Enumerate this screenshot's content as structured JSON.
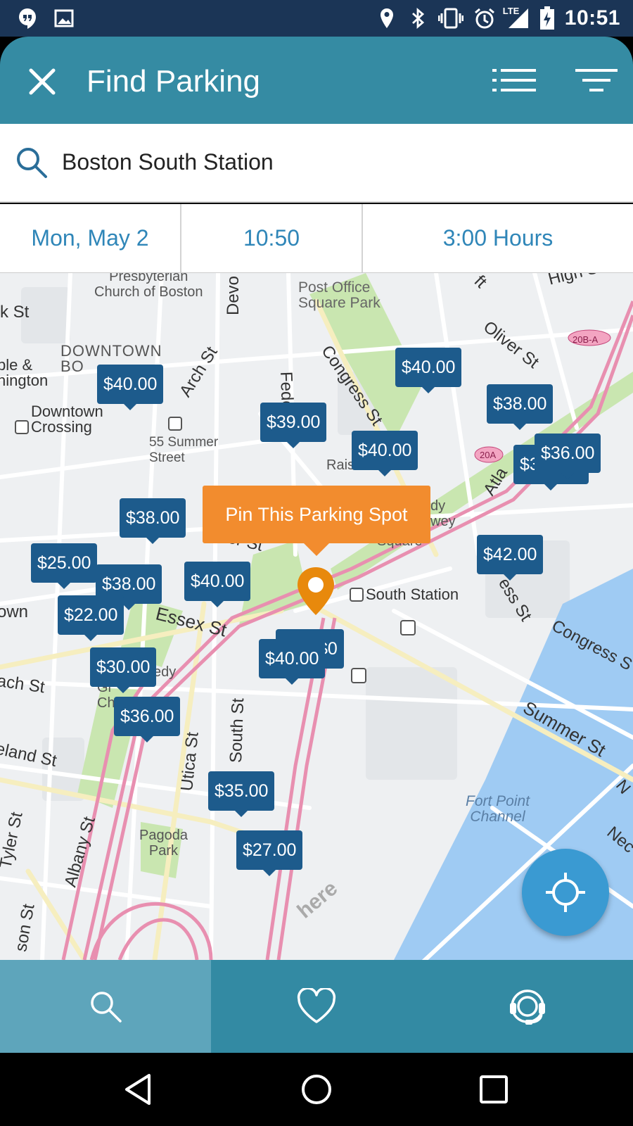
{
  "status_bar": {
    "time": "10:51",
    "network_label": "LTE",
    "icons": [
      "hangouts-icon",
      "image-icon",
      "location-icon",
      "bluetooth-icon",
      "vibrate-icon",
      "alarm-icon",
      "signal-icon",
      "battery-charging-icon"
    ]
  },
  "app_bar": {
    "title": "Find Parking",
    "close_icon": "close-icon",
    "list_icon": "list-view-icon",
    "filter_icon": "filter-icon"
  },
  "search": {
    "value": "Boston South Station",
    "icon": "search-icon"
  },
  "booking": {
    "date": "Mon, May 2",
    "time": "10:50",
    "duration": "3:00 Hours"
  },
  "map": {
    "place_labels": {
      "presbyterian": "Presbyterian\nChurch of Boston",
      "post_office": "Post Office\nSquare Park",
      "downtown": "DOWNTOWN\nBO",
      "temple": "ple &\nhington",
      "downtown_crossing": "Downtown\nCrossing",
      "summer_street": "55 Summer\nStreet",
      "south_station": "South Station",
      "fort_point": "Fort Point\nChannel",
      "pagoda": "Pagoda\nPark",
      "square": "Square",
      "greenway": "dy\nwey",
      "rais": "Rais",
      "gr": "Gr\nCh",
      "edy": "edy",
      "here_watermark": "here",
      "route_20a": "20A",
      "route_20ba": "20B-A"
    },
    "streets": {
      "high_st": "High St",
      "oliver_st": "Oliver St",
      "congress_st": "Congress St",
      "congress_s2": "Congress S",
      "federal": "Federa",
      "arch_st": "Arch St",
      "devo": "Devo",
      "k_st": "k St",
      "essex_st": "Essex St",
      "summer_st": "Summer St",
      "atla": "Atla",
      "ess_st": "ess St",
      "utica_st": "Utica St",
      "south_st": "South St",
      "albany_st": "Albany St",
      "tyler_st": "Tyler St",
      "eland_st": "eland St",
      "ach_st": "ach St",
      "own": "own",
      "son_st": "son St",
      "nec": "Nec",
      "n_st": "N",
      "er_st": "er St",
      "ft": "ft"
    },
    "price_markers": [
      "$40.00",
      "$40.00",
      "$38.00",
      "$39.00",
      "$40.00",
      "$36.00",
      "$3",
      "$38.00",
      "$42.00",
      "$25.00",
      "$38.00",
      "$40.00",
      "$22.00",
      "$40.00",
      "$0",
      "$30.00",
      "$36.00",
      "$35.00",
      "$27.00"
    ],
    "pin_label": "Pin This Parking Spot",
    "locate_icon": "my-location-icon",
    "colors": {
      "water": "#9fcbf3",
      "park": "#c9e6b0",
      "highway": "#e88fb0",
      "price_bg": "#1d5b8c",
      "pin": "#f28c2e"
    }
  },
  "tabs": [
    {
      "icon": "search-icon",
      "active": true
    },
    {
      "icon": "heart-icon",
      "active": false
    },
    {
      "icon": "support-headset-icon",
      "active": false
    }
  ],
  "nav_bar": {
    "back": "back-icon",
    "home": "home-icon",
    "recents": "recents-icon"
  }
}
